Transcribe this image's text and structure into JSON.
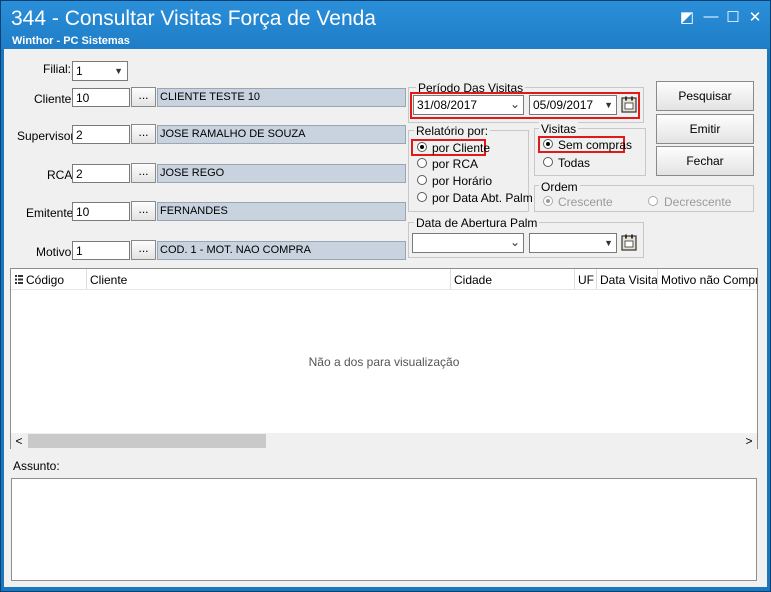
{
  "window": {
    "title": "344 - Consultar Visitas Força de Venda",
    "subtitle": "Winthor - PC Sistemas",
    "restore_glyph": "◩",
    "minimize_glyph": "—",
    "maximize_glyph": "☐",
    "close_glyph": "✕"
  },
  "form": {
    "filial": {
      "label": "Filial:",
      "value": "1"
    },
    "cliente": {
      "label": "Cliente",
      "code": "10",
      "description": "CLIENTE TESTE 10"
    },
    "supervisor": {
      "label": "Supervisor",
      "code": "2",
      "description": "JOSE RAMALHO DE SOUZA"
    },
    "rca": {
      "label": "RCA",
      "code": "2",
      "description": "JOSE REGO"
    },
    "emitente": {
      "label": "Emitente",
      "code": "10",
      "description": "FERNANDES"
    },
    "motivo": {
      "label": "Motivo",
      "code": "1",
      "description": "COD. 1 - MOT. NAO COMPRA"
    },
    "lookup_label": "..."
  },
  "periodo": {
    "title": "Período Das Visitas",
    "start_date": "31/08/2017",
    "end_date": "05/09/2017"
  },
  "relatorio": {
    "title": "Relatório por:",
    "options": [
      "por Cliente",
      "por RCA",
      "por Horário",
      "por Data Abt. Palm"
    ],
    "selected_index": 0
  },
  "visitas": {
    "title": "Visitas",
    "options": [
      "Sem compras",
      "Todas"
    ],
    "selected_index": 0
  },
  "ordem": {
    "title": "Ordem",
    "options": [
      "Crescente",
      "Decrescente"
    ],
    "selected_index": 0
  },
  "data_abertura": {
    "title": "Data de Abertura Palm",
    "start_date": "",
    "end_date": ""
  },
  "buttons": {
    "pesquisar": "Pesquisar",
    "emitir": "Emitir",
    "fechar": "Fechar"
  },
  "grid": {
    "columns": [
      "Código",
      "Cliente",
      "Cidade",
      "UF",
      "Data Visita",
      "Motivo não Compra"
    ],
    "empty_message": "Não a dos para visualização",
    "scroll_left": "<",
    "scroll_right": ">"
  },
  "assunto": {
    "label": "Assunto:",
    "value": ""
  },
  "colors": {
    "title_bar": "#1f7dc7",
    "highlight": "#e01919",
    "description_bg": "#c8d3df"
  },
  "icons": [
    "restore-icon",
    "minimize-icon",
    "maximize-icon",
    "close-icon",
    "dropdown-arrow-icon",
    "calendar-icon",
    "column-chooser-icon"
  ]
}
